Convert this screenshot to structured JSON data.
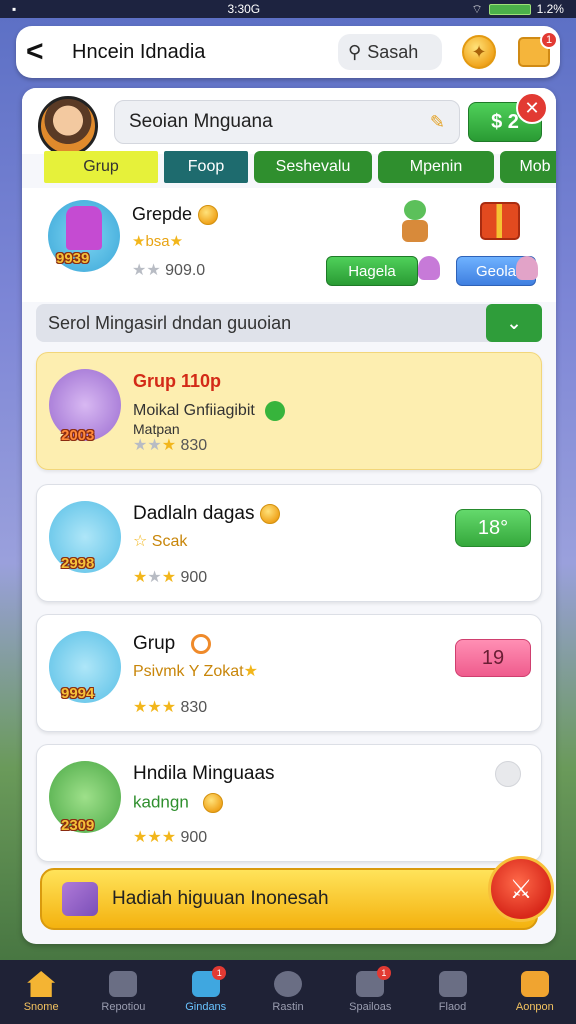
{
  "status": {
    "time": "3:30G",
    "battery": "1.2%"
  },
  "header": {
    "title": "Hncein Idnadia",
    "search_label": "Sasah",
    "notif_count": "1"
  },
  "player": {
    "name": "Seoian Mnguana",
    "action_label": "$ 2"
  },
  "tabs": [
    {
      "label": "Grup"
    },
    {
      "label": "Foop"
    },
    {
      "label": "Seshevalu"
    },
    {
      "label": "Mpenin"
    },
    {
      "label": "Mob"
    }
  ],
  "featured": {
    "title": "Grepde",
    "badge": "9939",
    "stars_text": "bsa",
    "rank": "909.0",
    "btn_primary": "Hagela",
    "btn_secondary": "Geola"
  },
  "filter": {
    "label": "Serol Mingasirl dndan guuoian"
  },
  "cards": [
    {
      "title": "Grup 110p",
      "subtitle": "Moikal Gnfiiagibit",
      "subtitle2": "Matpan",
      "badge": "2003",
      "rating": "830",
      "button": ""
    },
    {
      "title": "Dadlaln dagas",
      "subtitle": "Scak",
      "subtitle2": "",
      "badge": "2998",
      "rating": "900",
      "button": "18°"
    },
    {
      "title": "Grup",
      "subtitle": "Psivmk Y Zokat",
      "subtitle2": "",
      "badge": "9994",
      "rating": "830",
      "button": "19"
    },
    {
      "title": "Hndila Minguaas",
      "subtitle": "kadngn",
      "subtitle2": "",
      "badge": "2309",
      "rating": "900",
      "button": ""
    }
  ],
  "bottom_bar": {
    "label": "Hadiah higuuan Inonesah"
  },
  "nav": [
    {
      "label": "Snome",
      "badge": ""
    },
    {
      "label": "Repotiou",
      "badge": ""
    },
    {
      "label": "Gindans",
      "badge": "1"
    },
    {
      "label": "Rastin",
      "badge": ""
    },
    {
      "label": "Spailoas",
      "badge": "1"
    },
    {
      "label": "Flaod",
      "badge": ""
    },
    {
      "label": "Aonpon",
      "badge": ""
    }
  ]
}
